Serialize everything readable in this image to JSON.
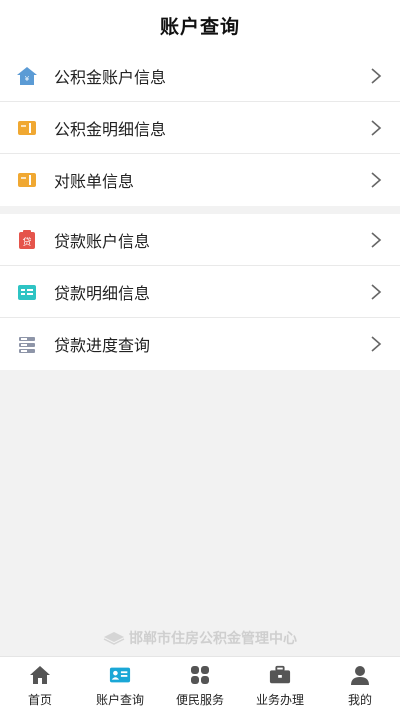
{
  "header": {
    "title": "账户查询"
  },
  "groups": [
    {
      "items": [
        {
          "label": "公积金账户信息",
          "icon": "house-icon"
        },
        {
          "label": "公积金明细信息",
          "icon": "detail-card-icon"
        },
        {
          "label": "对账单信息",
          "icon": "statement-icon"
        }
      ]
    },
    {
      "items": [
        {
          "label": "贷款账户信息",
          "icon": "loan-account-icon"
        },
        {
          "label": "贷款明细信息",
          "icon": "loan-detail-icon"
        },
        {
          "label": "贷款进度查询",
          "icon": "progress-icon"
        }
      ]
    }
  ],
  "footer": {
    "org_name": "邯郸市住房公积金管理中心"
  },
  "tabbar": {
    "items": [
      {
        "label": "首页",
        "icon": "home-icon"
      },
      {
        "label": "账户查询",
        "icon": "account-card-icon",
        "active": true
      },
      {
        "label": "便民服务",
        "icon": "grid-icon"
      },
      {
        "label": "业务办理",
        "icon": "briefcase-icon"
      },
      {
        "label": "我的",
        "icon": "user-icon"
      }
    ]
  },
  "colors": {
    "blue": "#5b9bd5",
    "orange": "#f0a832",
    "red": "#e5544b",
    "teal": "#2ec4c4",
    "gray": "#8e95a8",
    "active_tab": "#1aa7d6"
  }
}
